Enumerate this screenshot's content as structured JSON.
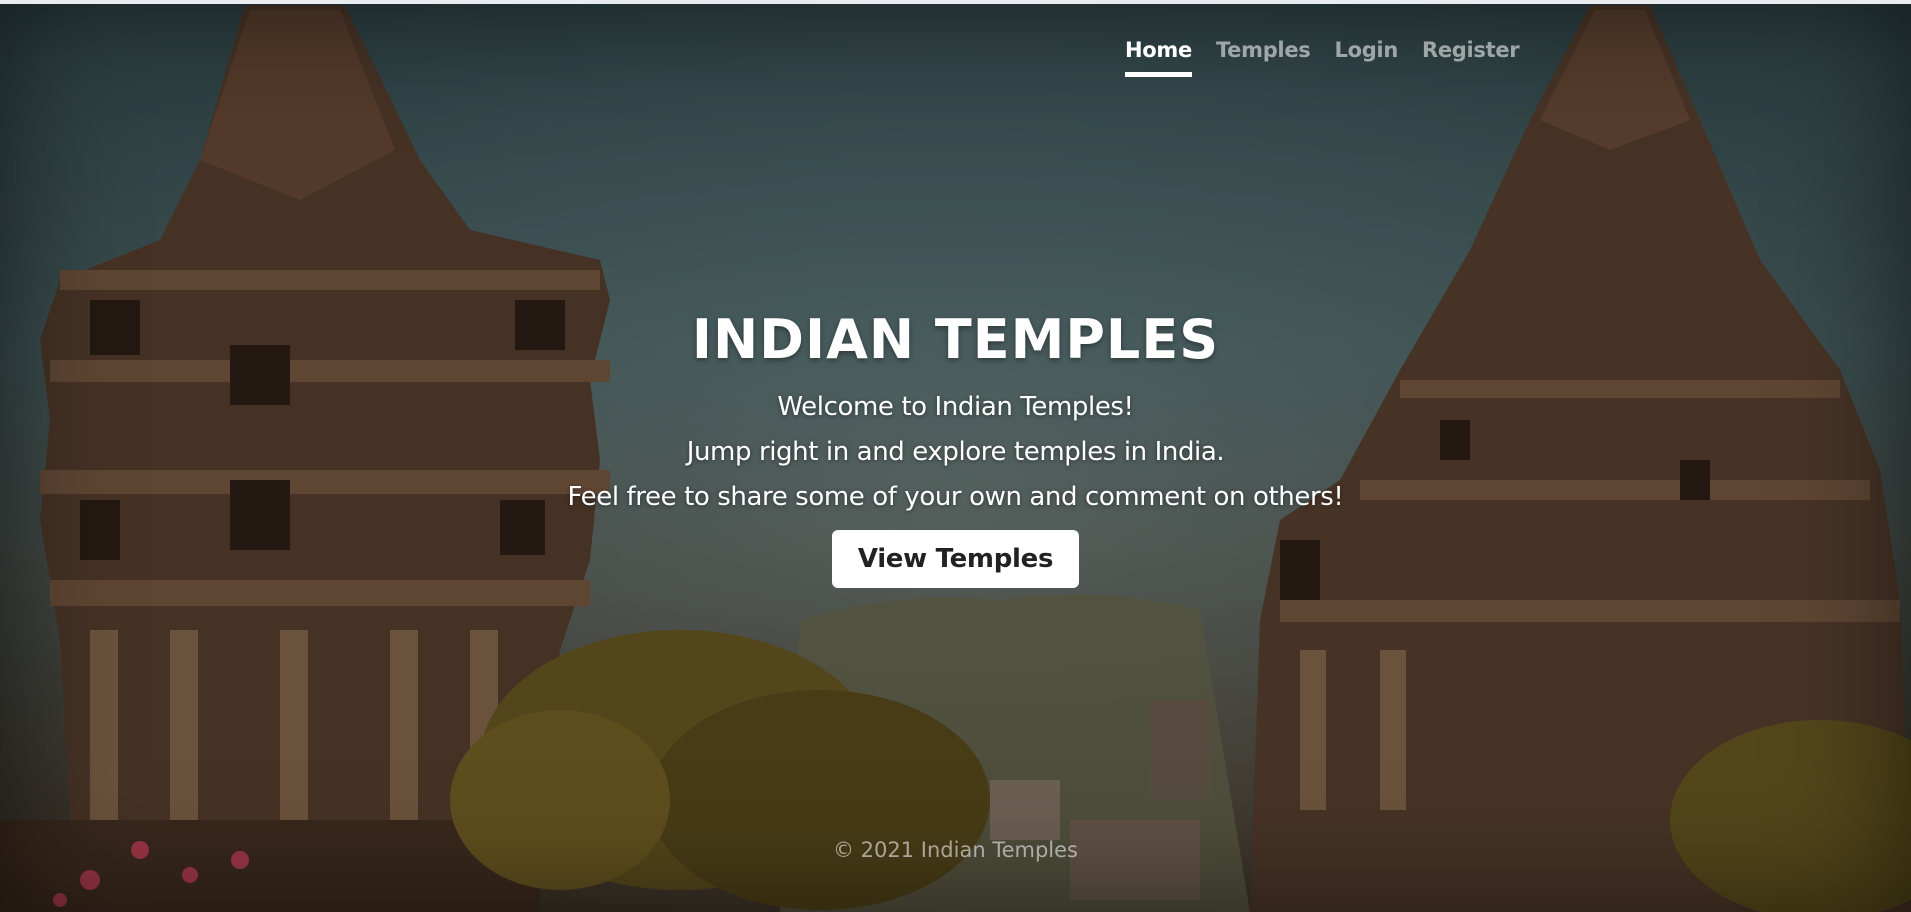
{
  "nav": {
    "items": [
      {
        "label": "Home",
        "active": true
      },
      {
        "label": "Temples",
        "active": false
      },
      {
        "label": "Login",
        "active": false
      },
      {
        "label": "Register",
        "active": false
      }
    ]
  },
  "hero": {
    "title": "INDIAN TEMPLES",
    "lines": [
      "Welcome to Indian Temples!",
      "Jump right in and explore temples in India.",
      "Feel free to share some of your own and comment on others!"
    ],
    "cta_label": "View Temples"
  },
  "footer": {
    "text": "© 2021 Indian Temples"
  },
  "colors": {
    "nav_active": "#ffffff",
    "nav_inactive": "rgba(255,255,255,0.55)",
    "button_bg": "#ffffff",
    "button_text": "#222222"
  },
  "background": {
    "icon": "temple-photo"
  }
}
